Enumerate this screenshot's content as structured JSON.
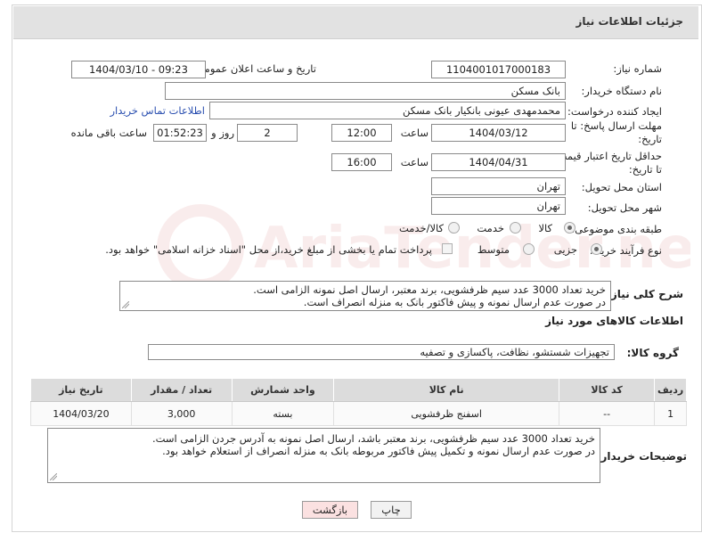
{
  "header": {
    "title": "جزئیات اطلاعات نیاز"
  },
  "need_number": {
    "label": "شماره نیاز:",
    "value": "1104001017000183"
  },
  "announce": {
    "label": "تاریخ و ساعت اعلان عمومی:",
    "value": "1404/03/10 - 09:23"
  },
  "buyer_org": {
    "label": "نام دستگاه خریدار:",
    "value": "بانک مسکن"
  },
  "creator": {
    "label": "ایجاد کننده درخواست:",
    "value": "محمدمهدی عیونی بانکیار بانک مسکن",
    "contact_link": "اطلاعات تماس خریدار"
  },
  "deadline": {
    "label": "مهلت ارسال پاسخ: تا تاریخ:",
    "date": "1404/03/12",
    "time_label": "ساعت",
    "time": "12:00",
    "days": "2",
    "days_label": "روز و",
    "remaining": "01:52:23",
    "remaining_label": "ساعت باقی مانده"
  },
  "price_validity": {
    "label": "حداقل تاریخ اعتبار قیمت: تا تاریخ:",
    "date": "1404/04/31",
    "time_label": "ساعت",
    "time": "16:00"
  },
  "province": {
    "label": "استان محل تحویل:",
    "value": "تهران"
  },
  "city": {
    "label": "شهر محل تحویل:",
    "value": "تهران"
  },
  "category": {
    "label": "طبقه بندی موضوعی:",
    "options": [
      "کالا",
      "خدمت",
      "کالا/خدمت"
    ],
    "selected": "کالا"
  },
  "process": {
    "label": "نوع فرآیند خرید :",
    "options": [
      "جزیی",
      "متوسط"
    ],
    "selected": "جزیی",
    "payment_note": "پرداخت تمام یا بخشی از مبلغ خرید،از محل \"اسناد خزانه اسلامی\" خواهد بود."
  },
  "description": {
    "label": "شرح کلی نیاز:",
    "line1": "خرید تعداد 3000 عدد سیم ظرفشویی، برند معتبر، ارسال اصل نمونه الزامی است.",
    "line2": "در صورت عدم ارسال نمونه و پیش فاکتور بانک به منزله انصراف است."
  },
  "goods_info": {
    "title": "اطلاعات کالاهای مورد نیاز"
  },
  "goods_group": {
    "label": "گروه کالا:",
    "value": "تجهیزات شستشو، نظافت، پاکسازی و تصفیه"
  },
  "table": {
    "headers": [
      "ردیف",
      "کد کالا",
      "نام کالا",
      "واحد شمارش",
      "تعداد / مقدار",
      "تاریخ نیاز"
    ],
    "rows": [
      {
        "row": "1",
        "code": "--",
        "name": "اسفنج ظرفشویی",
        "unit": "بسته",
        "qty": "3,000",
        "date": "1404/03/20"
      }
    ]
  },
  "buyer_notes": {
    "label": "توضیحات خریدار:",
    "line1": "خرید تعداد 3000 عدد سیم ظرفشویی، برند معتبر باشد، ارسال اصل نمونه به آدرس جردن الزامی است.",
    "line2": "در صورت عدم ارسال نمونه و تکمیل پیش فاکتور مربوطه بانک به منزله انصراف از استعلام خواهد بود."
  },
  "buttons": {
    "print": "چاپ",
    "back": "بازگشت"
  },
  "watermark": {
    "text": "AriaTender.neT"
  }
}
